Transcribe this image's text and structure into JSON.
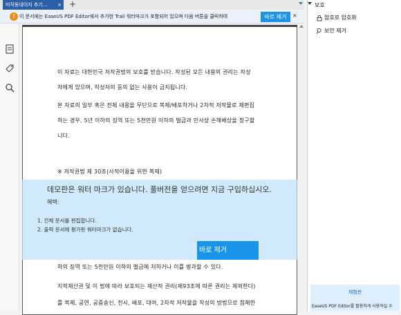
{
  "tab": {
    "title": "미작동대이지 추기...",
    "close": "×",
    "add": "+"
  },
  "notice": {
    "icon": "!",
    "text": "이 문서에는 EaseUS PDF Editor에서 추가한 Trail 워터마크가 포함되어 있으며 다음 버튼을 클릭하여",
    "button": "바로 제거",
    "close": "×"
  },
  "left_tools": [
    "document-icon",
    "tag-icon",
    "search-icon"
  ],
  "document": {
    "paragraphs": [
      "이 자료는 대한민국 저작권법의 보호를 받습니다. 작성된 모든 내용의 권리는 작성",
      "자에게 있으며, 작성자의 동의 없는 사용이 금지됩니다.",
      "본 자료의 일부 혹은 전체 내용을 무단으로 복제/배포하거나 2차적 저작물로 재편집",
      "하는 경우, 5년 이하의 징역 또는 5천만원 이하의 벌금과 민사상 손해배상을 청구할",
      "니다.",
      "※ 저작권법 제 30조(사적이용을 위한 복제)",
      "하의 징역 또는 5천만원 이하의 벌금에 처하거나 이를 병과할 수 있다.",
      "지적재산권 및 이 법에 따라 보호되는 재산적 권리(제93조에 따른 권리는 제외한다)",
      "를 복제, 공연, 공중송신, 전시, 배포, 대여, 2차적 저작물을 작성의 방법으로 침해한"
    ]
  },
  "watermark": {
    "title": "데모판은 워터 마크가 있습니다. 풀버전을 얻으려면 지금 구입하십시오.",
    "subtitle": "혜택:",
    "benefits": [
      "1. 전체 문서를 편집합니다.",
      "2. 출력 문서에 평가판 워터마크가 없습니다."
    ],
    "button": "바로 제거"
  },
  "right_panel": {
    "header": "보호",
    "items": [
      {
        "label": "암호로 암호화",
        "icon": "lock-icon"
      },
      {
        "label": "보안 제거",
        "icon": "key-icon"
      }
    ],
    "promo": {
      "title": "체험판",
      "text": "EaseUS PDF Editor를 활용하게 사용하실 수"
    }
  },
  "colors": {
    "accent": "#1a94e8",
    "tab": "#2d5fa8",
    "warning": "#f08a1a",
    "watermark_bg": "#bee1fa"
  }
}
